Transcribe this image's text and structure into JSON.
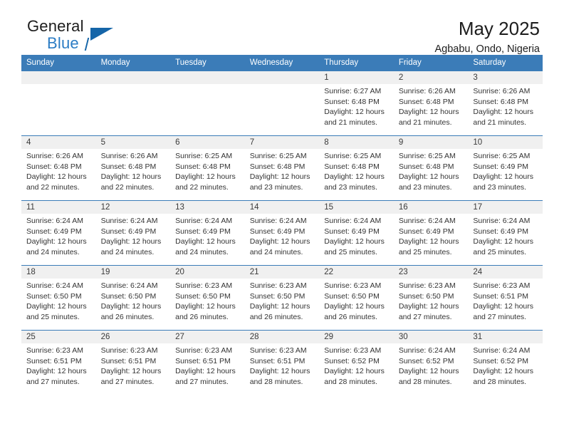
{
  "brand": {
    "name_top": "General",
    "name_bottom": "Blue",
    "triangle_color": "#1565a8",
    "blue_text_color": "#2b7cc4"
  },
  "header": {
    "title": "May 2025",
    "subtitle": "Agbabu, Ondo, Nigeria"
  },
  "colors": {
    "header_blue": "#3b7cb8",
    "daynum_bg": "#f0f0f0",
    "text": "#333333"
  },
  "weekday_headers": [
    "Sunday",
    "Monday",
    "Tuesday",
    "Wednesday",
    "Thursday",
    "Friday",
    "Saturday"
  ],
  "labels": {
    "sunrise_prefix": "Sunrise:",
    "sunset_prefix": "Sunset:",
    "daylight_prefix": "Daylight:"
  },
  "weeks": [
    [
      {
        "day": "",
        "empty": true
      },
      {
        "day": "",
        "empty": true
      },
      {
        "day": "",
        "empty": true
      },
      {
        "day": "",
        "empty": true
      },
      {
        "day": "1",
        "sunrise": "Sunrise: 6:27 AM",
        "sunset": "Sunset: 6:48 PM",
        "daylight_1": "Daylight: 12 hours",
        "daylight_2": "and 21 minutes."
      },
      {
        "day": "2",
        "sunrise": "Sunrise: 6:26 AM",
        "sunset": "Sunset: 6:48 PM",
        "daylight_1": "Daylight: 12 hours",
        "daylight_2": "and 21 minutes."
      },
      {
        "day": "3",
        "sunrise": "Sunrise: 6:26 AM",
        "sunset": "Sunset: 6:48 PM",
        "daylight_1": "Daylight: 12 hours",
        "daylight_2": "and 21 minutes."
      }
    ],
    [
      {
        "day": "4",
        "sunrise": "Sunrise: 6:26 AM",
        "sunset": "Sunset: 6:48 PM",
        "daylight_1": "Daylight: 12 hours",
        "daylight_2": "and 22 minutes."
      },
      {
        "day": "5",
        "sunrise": "Sunrise: 6:26 AM",
        "sunset": "Sunset: 6:48 PM",
        "daylight_1": "Daylight: 12 hours",
        "daylight_2": "and 22 minutes."
      },
      {
        "day": "6",
        "sunrise": "Sunrise: 6:25 AM",
        "sunset": "Sunset: 6:48 PM",
        "daylight_1": "Daylight: 12 hours",
        "daylight_2": "and 22 minutes."
      },
      {
        "day": "7",
        "sunrise": "Sunrise: 6:25 AM",
        "sunset": "Sunset: 6:48 PM",
        "daylight_1": "Daylight: 12 hours",
        "daylight_2": "and 23 minutes."
      },
      {
        "day": "8",
        "sunrise": "Sunrise: 6:25 AM",
        "sunset": "Sunset: 6:48 PM",
        "daylight_1": "Daylight: 12 hours",
        "daylight_2": "and 23 minutes."
      },
      {
        "day": "9",
        "sunrise": "Sunrise: 6:25 AM",
        "sunset": "Sunset: 6:48 PM",
        "daylight_1": "Daylight: 12 hours",
        "daylight_2": "and 23 minutes."
      },
      {
        "day": "10",
        "sunrise": "Sunrise: 6:25 AM",
        "sunset": "Sunset: 6:49 PM",
        "daylight_1": "Daylight: 12 hours",
        "daylight_2": "and 23 minutes."
      }
    ],
    [
      {
        "day": "11",
        "sunrise": "Sunrise: 6:24 AM",
        "sunset": "Sunset: 6:49 PM",
        "daylight_1": "Daylight: 12 hours",
        "daylight_2": "and 24 minutes."
      },
      {
        "day": "12",
        "sunrise": "Sunrise: 6:24 AM",
        "sunset": "Sunset: 6:49 PM",
        "daylight_1": "Daylight: 12 hours",
        "daylight_2": "and 24 minutes."
      },
      {
        "day": "13",
        "sunrise": "Sunrise: 6:24 AM",
        "sunset": "Sunset: 6:49 PM",
        "daylight_1": "Daylight: 12 hours",
        "daylight_2": "and 24 minutes."
      },
      {
        "day": "14",
        "sunrise": "Sunrise: 6:24 AM",
        "sunset": "Sunset: 6:49 PM",
        "daylight_1": "Daylight: 12 hours",
        "daylight_2": "and 24 minutes."
      },
      {
        "day": "15",
        "sunrise": "Sunrise: 6:24 AM",
        "sunset": "Sunset: 6:49 PM",
        "daylight_1": "Daylight: 12 hours",
        "daylight_2": "and 25 minutes."
      },
      {
        "day": "16",
        "sunrise": "Sunrise: 6:24 AM",
        "sunset": "Sunset: 6:49 PM",
        "daylight_1": "Daylight: 12 hours",
        "daylight_2": "and 25 minutes."
      },
      {
        "day": "17",
        "sunrise": "Sunrise: 6:24 AM",
        "sunset": "Sunset: 6:49 PM",
        "daylight_1": "Daylight: 12 hours",
        "daylight_2": "and 25 minutes."
      }
    ],
    [
      {
        "day": "18",
        "sunrise": "Sunrise: 6:24 AM",
        "sunset": "Sunset: 6:50 PM",
        "daylight_1": "Daylight: 12 hours",
        "daylight_2": "and 25 minutes."
      },
      {
        "day": "19",
        "sunrise": "Sunrise: 6:24 AM",
        "sunset": "Sunset: 6:50 PM",
        "daylight_1": "Daylight: 12 hours",
        "daylight_2": "and 26 minutes."
      },
      {
        "day": "20",
        "sunrise": "Sunrise: 6:23 AM",
        "sunset": "Sunset: 6:50 PM",
        "daylight_1": "Daylight: 12 hours",
        "daylight_2": "and 26 minutes."
      },
      {
        "day": "21",
        "sunrise": "Sunrise: 6:23 AM",
        "sunset": "Sunset: 6:50 PM",
        "daylight_1": "Daylight: 12 hours",
        "daylight_2": "and 26 minutes."
      },
      {
        "day": "22",
        "sunrise": "Sunrise: 6:23 AM",
        "sunset": "Sunset: 6:50 PM",
        "daylight_1": "Daylight: 12 hours",
        "daylight_2": "and 26 minutes."
      },
      {
        "day": "23",
        "sunrise": "Sunrise: 6:23 AM",
        "sunset": "Sunset: 6:50 PM",
        "daylight_1": "Daylight: 12 hours",
        "daylight_2": "and 27 minutes."
      },
      {
        "day": "24",
        "sunrise": "Sunrise: 6:23 AM",
        "sunset": "Sunset: 6:51 PM",
        "daylight_1": "Daylight: 12 hours",
        "daylight_2": "and 27 minutes."
      }
    ],
    [
      {
        "day": "25",
        "sunrise": "Sunrise: 6:23 AM",
        "sunset": "Sunset: 6:51 PM",
        "daylight_1": "Daylight: 12 hours",
        "daylight_2": "and 27 minutes."
      },
      {
        "day": "26",
        "sunrise": "Sunrise: 6:23 AM",
        "sunset": "Sunset: 6:51 PM",
        "daylight_1": "Daylight: 12 hours",
        "daylight_2": "and 27 minutes."
      },
      {
        "day": "27",
        "sunrise": "Sunrise: 6:23 AM",
        "sunset": "Sunset: 6:51 PM",
        "daylight_1": "Daylight: 12 hours",
        "daylight_2": "and 27 minutes."
      },
      {
        "day": "28",
        "sunrise": "Sunrise: 6:23 AM",
        "sunset": "Sunset: 6:51 PM",
        "daylight_1": "Daylight: 12 hours",
        "daylight_2": "and 28 minutes."
      },
      {
        "day": "29",
        "sunrise": "Sunrise: 6:23 AM",
        "sunset": "Sunset: 6:52 PM",
        "daylight_1": "Daylight: 12 hours",
        "daylight_2": "and 28 minutes."
      },
      {
        "day": "30",
        "sunrise": "Sunrise: 6:24 AM",
        "sunset": "Sunset: 6:52 PM",
        "daylight_1": "Daylight: 12 hours",
        "daylight_2": "and 28 minutes."
      },
      {
        "day": "31",
        "sunrise": "Sunrise: 6:24 AM",
        "sunset": "Sunset: 6:52 PM",
        "daylight_1": "Daylight: 12 hours",
        "daylight_2": "and 28 minutes."
      }
    ]
  ]
}
